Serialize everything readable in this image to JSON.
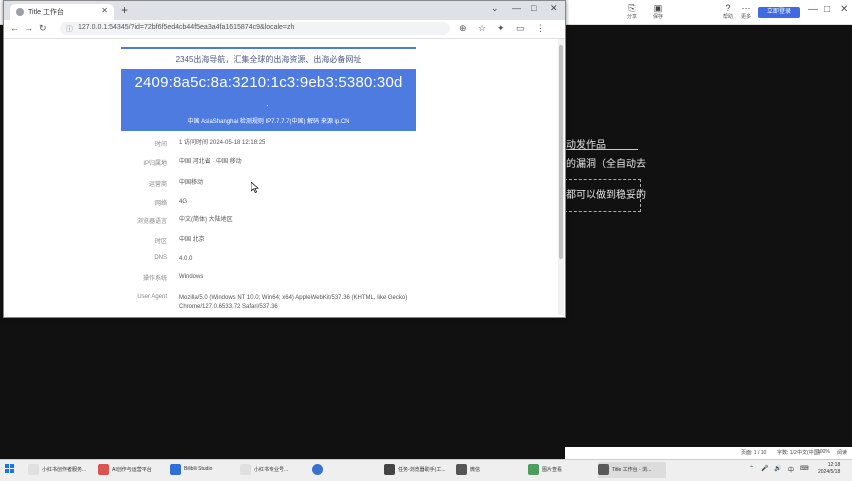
{
  "app": {
    "tools": [
      {
        "label": "分享",
        "icon": "share-icon"
      },
      {
        "label": "保存",
        "icon": "save-icon"
      },
      {
        "label": "帮助",
        "icon": "help-icon"
      },
      {
        "label": "更多",
        "icon": "more-icon"
      }
    ],
    "primary_button": "立即登录",
    "window_controls": [
      "—",
      "□",
      "✕"
    ]
  },
  "background_doc": {
    "line1": "动发作品",
    "line2": "的漏洞（全自动去",
    "line3": "都可以做到稳妥的"
  },
  "browser": {
    "tab_title": "Title 工作台",
    "tab_close": "✕",
    "new_tab": "+",
    "window_controls": [
      "⌄",
      "—",
      "□",
      "✕"
    ],
    "url": "127.0.0.1:54345/?id=72bf6f5ed4cb44f5ea3a4fa1615874c9&locale=zh",
    "nav": [
      "←",
      "→",
      "↻"
    ],
    "toolbar_icons": [
      "⊕",
      "☆",
      "✦",
      "▭",
      "⋮"
    ]
  },
  "page": {
    "promo": "2345出海导航，汇集全球的出海资源、出海必备网址",
    "ip": "2409:8a5c:8a:3210:1c3:9eb3:5380:30d",
    "ip_dot": "·",
    "banner_info": "中国 AsiaShanghai   检测规则 IP7.7.7.7(中国)   解码   来源 ip.CN",
    "rows": [
      {
        "key": "时间",
        "value": "1  访问时间 2024-05-18 12:18:25"
      },
      {
        "key": "IP归属地",
        "value": "中国 河北省 · 中国 移动"
      },
      {
        "key": "运营商",
        "value": "中国移动"
      },
      {
        "key": "网络",
        "value": "4G"
      },
      {
        "key": "浏览器语言",
        "value": "中文(简体) 大陆地区"
      },
      {
        "key": "时区",
        "value": "中国 北京"
      },
      {
        "key": "DNS",
        "value": "4.0.0"
      },
      {
        "key": "操作系统",
        "value": "Windows"
      },
      {
        "key": "User Agent",
        "value": "Mozilla/5.0 (Windows NT 10.0; Win64; x64) AppleWebKit/537.36 (KHTML, like Gecko) Chrome/127.0.6533.72 Safari/537.36"
      }
    ]
  },
  "status_strip": {
    "page": "页面: 1 / 10",
    "words": "字数: 1/2",
    "language": "中文(中国)",
    "zoom": "100%",
    "mode": "阅读"
  },
  "taskbar": {
    "items": [
      {
        "label": "小红书创作者服务...",
        "color": "#e0e0e0"
      },
      {
        "label": "AI创作与运营平台",
        "color": "#d9534f"
      },
      {
        "label": "Bilibili Studio",
        "color": "#2e6fd8"
      },
      {
        "label": "小红书专业号...",
        "color": "#e0e0e0"
      },
      {
        "label": "",
        "color": "#3b6fd0"
      },
      {
        "label": "任务-浏览器助手(工...",
        "color": "#444"
      },
      {
        "label": "微信",
        "color": "#555"
      },
      {
        "label": "图片查看",
        "color": "#4a9d5b"
      },
      {
        "label": "Title 工作台 - 浏...",
        "color": "#5a5a5a"
      }
    ],
    "tray": [
      "⌃",
      "🎤",
      "🔊",
      "中",
      "⌨"
    ],
    "time": "12:18",
    "date": "2024/5/18"
  }
}
